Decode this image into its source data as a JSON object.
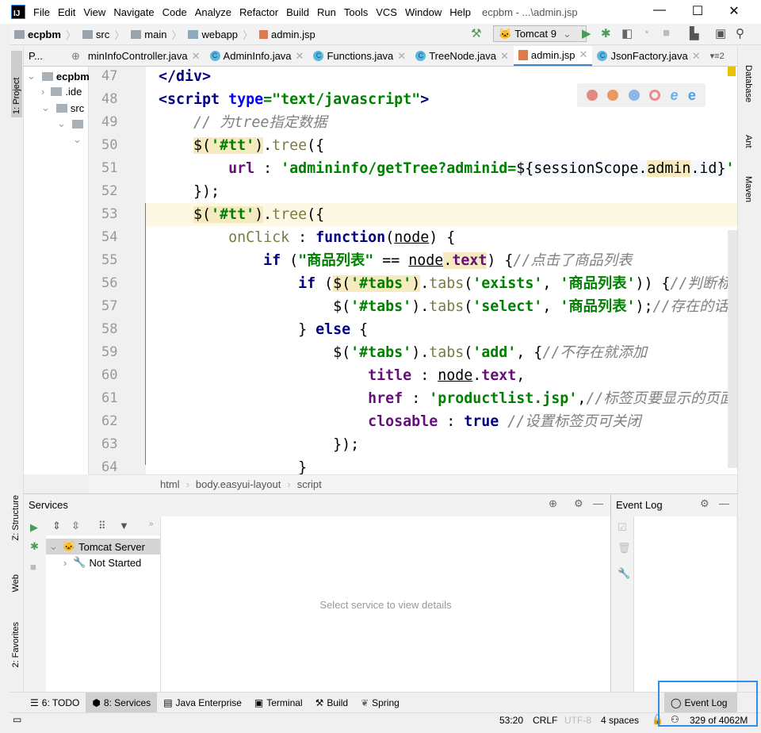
{
  "titlebar": {
    "logo": "IJ",
    "menus": [
      "File",
      "Edit",
      "View",
      "Navigate",
      "Code",
      "Analyze",
      "Refactor",
      "Build",
      "Run",
      "Tools",
      "VCS",
      "Window",
      "Help"
    ],
    "title": "ecpbm - ...\\admin.jsp"
  },
  "navbar": {
    "crumbs": [
      "ecpbm",
      "src",
      "main",
      "webapp",
      "admin.jsp"
    ],
    "run_config": "Tomcat 9"
  },
  "tabs": {
    "project_tab": "P...",
    "items": [
      {
        "label": "minInfoController.java",
        "icon": "c"
      },
      {
        "label": "AdminInfo.java",
        "icon": "c"
      },
      {
        "label": "Functions.java",
        "icon": "c"
      },
      {
        "label": "TreeNode.java",
        "icon": "c"
      },
      {
        "label": "admin.jsp",
        "icon": "jsp",
        "active": true
      },
      {
        "label": "JsonFactory.java",
        "icon": "c"
      }
    ],
    "overflow": "2"
  },
  "left_stripe": {
    "project": "1: Project",
    "structure": "Z: Structure",
    "web": "Web",
    "favorites": "2: Favorites"
  },
  "right_stripe": {
    "database": "Database",
    "ant": "Ant",
    "maven": "Maven"
  },
  "project_tree": [
    {
      "label": "ecpbm",
      "bold": true
    },
    {
      "label": ".ide"
    },
    {
      "label": "src"
    }
  ],
  "editor": {
    "current_line": 53,
    "lines": [
      {
        "n": 47,
        "tokens": [
          {
            "t": "</div>",
            "c": "tag"
          }
        ]
      },
      {
        "n": 48,
        "tokens": [
          {
            "t": "<script ",
            "c": "tag"
          },
          {
            "t": "type",
            "c": "attr"
          },
          {
            "t": "=\"text/javascript\"",
            "c": "str"
          },
          {
            "t": ">",
            "c": "tag"
          }
        ]
      },
      {
        "n": 49,
        "tokens": [
          {
            "t": "    "
          },
          {
            "t": "// 为tree指定数据",
            "c": "cmt"
          }
        ]
      },
      {
        "n": 50,
        "tokens": [
          {
            "t": "    "
          },
          {
            "t": "$(",
            "c": "pl hl"
          },
          {
            "t": "'#tt'",
            "c": "str hl"
          },
          {
            "t": ")",
            "c": "pl hl"
          },
          {
            "t": ".",
            "c": "pl"
          },
          {
            "t": "tree",
            "c": "mth"
          },
          {
            "t": "({",
            "c": "pl"
          }
        ]
      },
      {
        "n": 51,
        "tokens": [
          {
            "t": "        "
          },
          {
            "t": "url",
            "c": "fld"
          },
          {
            "t": " : ",
            "c": "pl"
          },
          {
            "t": "'admininfo/getTree?adminid=",
            "c": "str"
          },
          {
            "t": "${sessionScope.",
            "c": "pl inj"
          },
          {
            "t": "admin",
            "c": "pl hl"
          },
          {
            "t": ".id}",
            "c": "pl inj"
          },
          {
            "t": "'",
            "c": "str"
          }
        ]
      },
      {
        "n": 52,
        "tokens": [
          {
            "t": "    });",
            "c": "pl"
          }
        ]
      },
      {
        "n": 53,
        "tokens": [
          {
            "t": "    "
          },
          {
            "t": "$(",
            "c": "pl hl"
          },
          {
            "t": "'#tt'",
            "c": "str hl"
          },
          {
            "t": ")",
            "c": "pl hl"
          },
          {
            "t": ".",
            "c": "pl"
          },
          {
            "t": "tree",
            "c": "mth"
          },
          {
            "t": "(",
            "c": "pl"
          },
          {
            "t": "{",
            "c": "pl"
          }
        ]
      },
      {
        "n": 54,
        "tokens": [
          {
            "t": "        "
          },
          {
            "t": "onClick",
            "c": "mth"
          },
          {
            "t": " : ",
            "c": "pl"
          },
          {
            "t": "function",
            "c": "kw"
          },
          {
            "t": "(",
            "c": "pl"
          },
          {
            "t": "node",
            "c": "pl ul"
          },
          {
            "t": ") {",
            "c": "pl"
          }
        ]
      },
      {
        "n": 55,
        "tokens": [
          {
            "t": "            "
          },
          {
            "t": "if",
            "c": "kw"
          },
          {
            "t": " (",
            "c": "pl"
          },
          {
            "t": "\"商品列表\"",
            "c": "str"
          },
          {
            "t": " == ",
            "c": "pl"
          },
          {
            "t": "node",
            "c": "pl ul"
          },
          {
            "t": ".",
            "c": "pl hl"
          },
          {
            "t": "text",
            "c": "fld hl"
          },
          {
            "t": ") {",
            "c": "pl"
          },
          {
            "t": "//点击了商品列表",
            "c": "cmt"
          }
        ]
      },
      {
        "n": 56,
        "tokens": [
          {
            "t": "                "
          },
          {
            "t": "if",
            "c": "kw"
          },
          {
            "t": " (",
            "c": "pl"
          },
          {
            "t": "$(",
            "c": "pl hl"
          },
          {
            "t": "'#tabs'",
            "c": "str hl"
          },
          {
            "t": ")",
            "c": "pl hl"
          },
          {
            "t": ".",
            "c": "pl"
          },
          {
            "t": "tabs",
            "c": "mth"
          },
          {
            "t": "(",
            "c": "pl"
          },
          {
            "t": "'exists'",
            "c": "str"
          },
          {
            "t": ", ",
            "c": "pl"
          },
          {
            "t": "'商品列表'",
            "c": "str"
          },
          {
            "t": ")) {",
            "c": "pl"
          },
          {
            "t": "//判断标",
            "c": "cmt"
          }
        ]
      },
      {
        "n": 57,
        "tokens": [
          {
            "t": "                    "
          },
          {
            "t": "$(",
            "c": "pl"
          },
          {
            "t": "'#tabs'",
            "c": "str"
          },
          {
            "t": ")",
            "c": "pl"
          },
          {
            "t": ".",
            "c": "pl"
          },
          {
            "t": "tabs",
            "c": "mth"
          },
          {
            "t": "(",
            "c": "pl"
          },
          {
            "t": "'select'",
            "c": "str"
          },
          {
            "t": ", ",
            "c": "pl"
          },
          {
            "t": "'商品列表'",
            "c": "str"
          },
          {
            "t": ");",
            "c": "pl"
          },
          {
            "t": "//存在的话",
            "c": "cmt"
          }
        ]
      },
      {
        "n": 58,
        "tokens": [
          {
            "t": "                } ",
            "c": "pl"
          },
          {
            "t": "else",
            "c": "kw"
          },
          {
            "t": " {",
            "c": "pl"
          }
        ]
      },
      {
        "n": 59,
        "tokens": [
          {
            "t": "                    "
          },
          {
            "t": "$(",
            "c": "pl"
          },
          {
            "t": "'#tabs'",
            "c": "str"
          },
          {
            "t": ")",
            "c": "pl"
          },
          {
            "t": ".",
            "c": "pl"
          },
          {
            "t": "tabs",
            "c": "mth"
          },
          {
            "t": "(",
            "c": "pl"
          },
          {
            "t": "'add'",
            "c": "str"
          },
          {
            "t": ", {",
            "c": "pl"
          },
          {
            "t": "//不存在就添加",
            "c": "cmt"
          }
        ]
      },
      {
        "n": 60,
        "tokens": [
          {
            "t": "                        "
          },
          {
            "t": "title",
            "c": "fld"
          },
          {
            "t": " : ",
            "c": "pl"
          },
          {
            "t": "node",
            "c": "pl ul"
          },
          {
            "t": ".",
            "c": "pl"
          },
          {
            "t": "text",
            "c": "fld"
          },
          {
            "t": ",",
            "c": "pl"
          }
        ]
      },
      {
        "n": 61,
        "tokens": [
          {
            "t": "                        "
          },
          {
            "t": "href",
            "c": "fld"
          },
          {
            "t": " : ",
            "c": "pl"
          },
          {
            "t": "'productlist.jsp'",
            "c": "str"
          },
          {
            "t": ",",
            "c": "pl"
          },
          {
            "t": "//标签页要显示的页面",
            "c": "cmt"
          }
        ]
      },
      {
        "n": 62,
        "tokens": [
          {
            "t": "                        "
          },
          {
            "t": "closable",
            "c": "fld"
          },
          {
            "t": " : ",
            "c": "pl"
          },
          {
            "t": "true",
            "c": "kw"
          },
          {
            "t": " ",
            "c": "pl"
          },
          {
            "t": "//设置标签页可关闭",
            "c": "cmt"
          }
        ]
      },
      {
        "n": 63,
        "tokens": [
          {
            "t": "                    });",
            "c": "pl"
          }
        ]
      },
      {
        "n": 64,
        "tokens": [
          {
            "t": "                }",
            "c": "pl"
          }
        ]
      }
    ]
  },
  "breadcrumb": [
    "html",
    "body.easyui-layout",
    "script"
  ],
  "services": {
    "title": "Services",
    "tree": [
      {
        "label": "Tomcat Server"
      },
      {
        "label": "Not Started"
      }
    ],
    "placeholder": "Select service to view details"
  },
  "event_log": {
    "title": "Event Log"
  },
  "bottom_tabs": [
    {
      "label": "6: TODO"
    },
    {
      "label": "8: Services",
      "selected": true
    },
    {
      "label": "Java Enterprise"
    },
    {
      "label": "Terminal"
    },
    {
      "label": "Build"
    },
    {
      "label": "Spring"
    },
    {
      "label": "Event Log"
    }
  ],
  "status": {
    "position": "53:20",
    "line_sep": "CRLF",
    "encoding": "UTF-8",
    "indent": "4 spaces",
    "memory": "329 of 4062M"
  },
  "colors": {
    "accent": "#4083c9",
    "run_green": "#499c54",
    "highlight_box": "#2f8ee5"
  }
}
